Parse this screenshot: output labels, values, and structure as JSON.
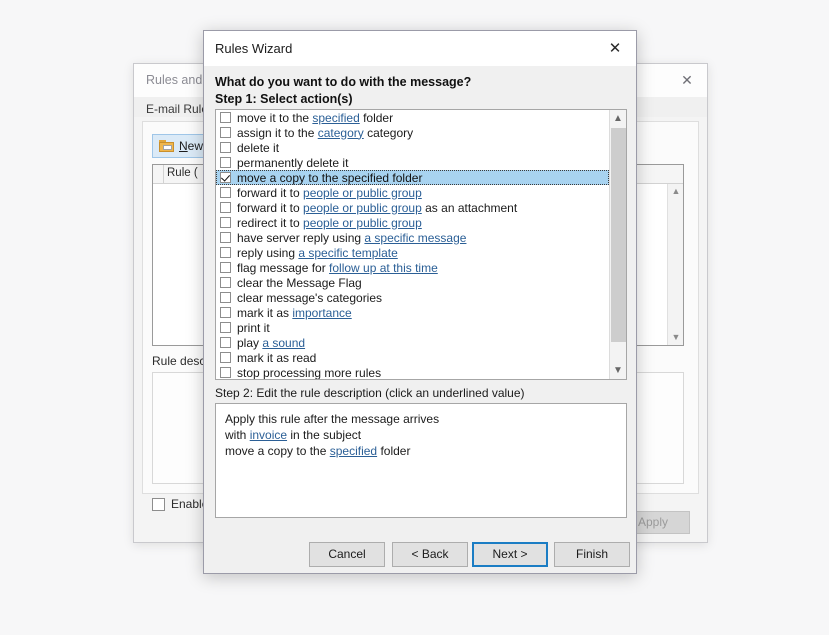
{
  "background_window": {
    "title": "Rules and A",
    "close_icon": "close-icon",
    "tab_label": "E-mail Rule",
    "new_rule_button": {
      "prefix": "",
      "underlined": "N",
      "label": "ew R",
      "icon": "new-folder-icon"
    },
    "rule_list_header": "Rule (",
    "rule_description_label": "Rule descr",
    "enable_checkbox_label": "Enable",
    "apply_button": "Apply",
    "scroll_up_icon": "chevron-up-icon",
    "scroll_down_icon": "chevron-down-icon"
  },
  "dialog": {
    "title": "Rules Wizard",
    "close_icon": "close-icon",
    "question": "What do you want to do with the message?",
    "step1_label": "Step 1: Select action(s)",
    "step2_label": "Step 2: Edit the rule description (click an underlined value)",
    "scroll_up_icon": "chevron-up-icon",
    "scroll_down_icon": "chevron-down-icon",
    "actions": [
      {
        "checked": false,
        "selected": false,
        "parts": [
          {
            "t": "move it to the ",
            "link": false
          },
          {
            "t": "specified",
            "link": true
          },
          {
            "t": " folder",
            "link": false
          }
        ]
      },
      {
        "checked": false,
        "selected": false,
        "parts": [
          {
            "t": "assign it to the ",
            "link": false
          },
          {
            "t": "category",
            "link": true
          },
          {
            "t": " category",
            "link": false
          }
        ]
      },
      {
        "checked": false,
        "selected": false,
        "parts": [
          {
            "t": "delete it",
            "link": false
          }
        ]
      },
      {
        "checked": false,
        "selected": false,
        "parts": [
          {
            "t": "permanently delete it",
            "link": false
          }
        ]
      },
      {
        "checked": true,
        "selected": true,
        "parts": [
          {
            "t": "move a copy to the specified folder",
            "link": false
          }
        ]
      },
      {
        "checked": false,
        "selected": false,
        "parts": [
          {
            "t": "forward it to ",
            "link": false
          },
          {
            "t": "people or public group",
            "link": true
          }
        ]
      },
      {
        "checked": false,
        "selected": false,
        "parts": [
          {
            "t": "forward it to ",
            "link": false
          },
          {
            "t": "people or public group",
            "link": true
          },
          {
            "t": " as an attachment",
            "link": false
          }
        ]
      },
      {
        "checked": false,
        "selected": false,
        "parts": [
          {
            "t": "redirect it to ",
            "link": false
          },
          {
            "t": "people or public group",
            "link": true
          }
        ]
      },
      {
        "checked": false,
        "selected": false,
        "parts": [
          {
            "t": "have server reply using ",
            "link": false
          },
          {
            "t": "a specific message",
            "link": true
          }
        ]
      },
      {
        "checked": false,
        "selected": false,
        "parts": [
          {
            "t": "reply using ",
            "link": false
          },
          {
            "t": "a specific template",
            "link": true
          }
        ]
      },
      {
        "checked": false,
        "selected": false,
        "parts": [
          {
            "t": "flag message for ",
            "link": false
          },
          {
            "t": "follow up at this time",
            "link": true
          }
        ]
      },
      {
        "checked": false,
        "selected": false,
        "parts": [
          {
            "t": "clear the Message Flag",
            "link": false
          }
        ]
      },
      {
        "checked": false,
        "selected": false,
        "parts": [
          {
            "t": "clear message's categories",
            "link": false
          }
        ]
      },
      {
        "checked": false,
        "selected": false,
        "parts": [
          {
            "t": "mark it as ",
            "link": false
          },
          {
            "t": "importance",
            "link": true
          }
        ]
      },
      {
        "checked": false,
        "selected": false,
        "parts": [
          {
            "t": "print it",
            "link": false
          }
        ]
      },
      {
        "checked": false,
        "selected": false,
        "parts": [
          {
            "t": "play ",
            "link": false
          },
          {
            "t": "a sound",
            "link": true
          }
        ]
      },
      {
        "checked": false,
        "selected": false,
        "parts": [
          {
            "t": "mark it as read",
            "link": false
          }
        ]
      },
      {
        "checked": false,
        "selected": false,
        "parts": [
          {
            "t": "stop processing more rules",
            "link": false
          }
        ]
      }
    ],
    "description_lines": [
      [
        {
          "t": "Apply this rule after the message arrives",
          "link": false
        }
      ],
      [
        {
          "t": "with ",
          "link": false
        },
        {
          "t": "invoice",
          "link": true
        },
        {
          "t": " in the subject",
          "link": false
        }
      ],
      [
        {
          "t": "move a copy to the ",
          "link": false
        },
        {
          "t": "specified",
          "link": true
        },
        {
          "t": " folder",
          "link": false
        }
      ]
    ],
    "buttons": {
      "cancel": "Cancel",
      "back": "< Back",
      "next": "Next >",
      "finish": "Finish",
      "focused": "next"
    }
  },
  "colors": {
    "selection_blue": "#a8d3f0",
    "link_blue": "#2b5f96",
    "focus_blue": "#1b7dc4",
    "dialog_bg": "#f0f0f0"
  }
}
